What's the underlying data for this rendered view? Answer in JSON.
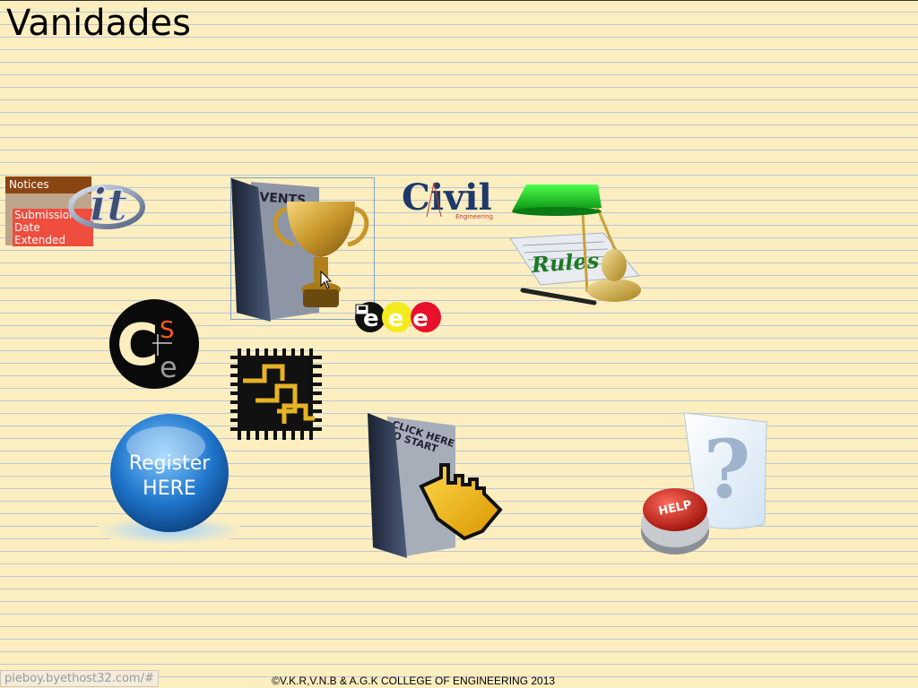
{
  "page": {
    "title": "Vanidades",
    "footer_url": "pieboy.byethost32.com/#",
    "copyright": "©V.K.R,V.N.B & A.G.K COLLEGE OF ENGINEERING 2013"
  },
  "notices": {
    "header": "Notices",
    "item_line1": "Submission",
    "item_line2": "Date Extended"
  },
  "icons": {
    "it": {
      "text": "it",
      "icon": "it-logo"
    },
    "events": {
      "folder_text": "EVENTS",
      "icon": "events-trophy-folder"
    },
    "civil": {
      "text": "Civil",
      "sub": "Engineering",
      "icon": "civil-logo"
    },
    "rules": {
      "text": "Rules",
      "icon": "rules-lamp"
    },
    "cse": {
      "c": "C",
      "s": "S",
      "e": "e",
      "icon": "cse-logo"
    },
    "eee": {
      "text": "eee",
      "icon": "eee-logo"
    },
    "ece": {
      "icon": "ece-chip-logo"
    },
    "register": {
      "line1": "Register",
      "line2": "HERE",
      "icon": "register-button"
    },
    "start": {
      "line1": "CLICK HERE",
      "line2": "TO START",
      "icon": "click-start-folder"
    },
    "help": {
      "button_text": "HELP",
      "question": "?",
      "icon": "help-question"
    }
  },
  "colors": {
    "background": "#fdeec0",
    "notices_header": "#8b4513",
    "notice_item": "#ef4d3e",
    "lamp_green": "#11c21a",
    "register_blue": "#1e73c9"
  }
}
